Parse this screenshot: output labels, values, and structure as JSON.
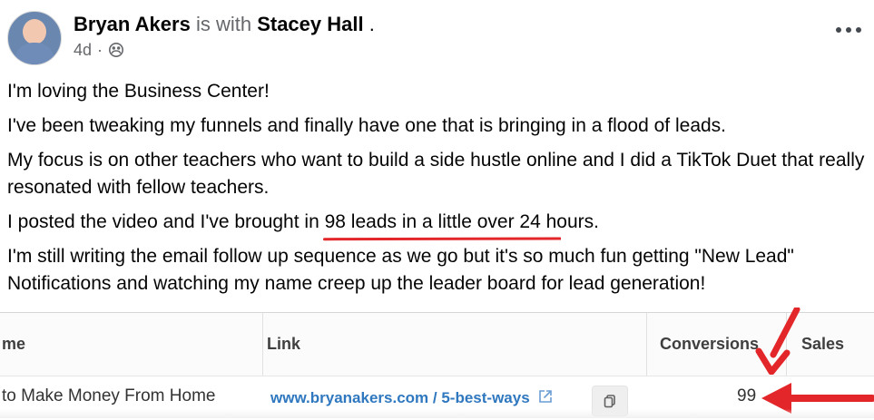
{
  "post": {
    "author": "Bryan Akers",
    "with_text": "is with",
    "tagged_person": "Stacey Hall",
    "period": ".",
    "time": "4d",
    "dot_separator": "·",
    "audience_icon": "friends-globe-icon",
    "more_icon": "more-options-icon",
    "paragraphs": [
      "I'm loving the Business Center!",
      "I've been tweaking my funnels and finally have one that is bringing in a flood of leads.",
      "My focus is on other teachers who want to build a side hustle online and I did a TikTok Duet that really resonated with fellow teachers.",
      "I posted the video and I've brought in",
      "98 leads in a little over 24 hours.",
      "I'm still writing the email follow up sequence as we go but it's so much fun getting \"New Lead\" Notifications and watching my name creep up the leader board for lead generation!"
    ]
  },
  "table": {
    "headers": {
      "name": "me",
      "link": "Link",
      "conversions": "Conversions",
      "sales": "Sales"
    },
    "row": {
      "name": "to Make Money From Home",
      "link": "www.bryanakers.com / 5-best-ways",
      "conversions": "99",
      "sales": ""
    }
  },
  "annotations": {
    "underline_color": "#e3262a",
    "arrow_color": "#e3262a"
  },
  "icons": {
    "external_link": "external-link-icon",
    "copy": "copy-icon"
  }
}
